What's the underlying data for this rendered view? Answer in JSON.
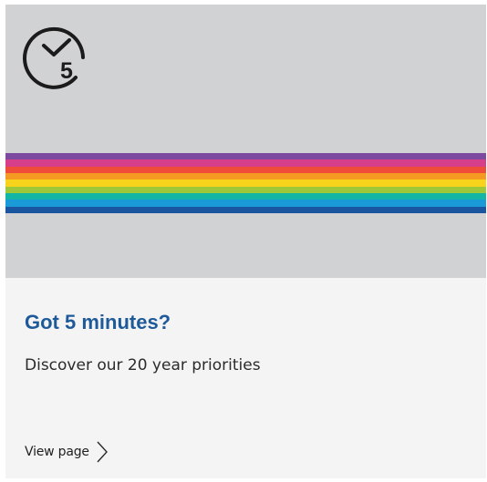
{
  "card": {
    "icon": {
      "name": "clock-5-minutes-icon",
      "number": "5"
    },
    "banner": {
      "stripes": [
        "#7c4a9e",
        "#d83f8a",
        "#ef4c39",
        "#f49a22",
        "#f8d31c",
        "#9ec83a",
        "#13b5a4",
        "#1a9ad6",
        "#1a56a0"
      ]
    },
    "title": "Got 5 minutes?",
    "description": "Discover our 20 year priorities",
    "link": {
      "label": "View page",
      "icon": "chevron-right-icon"
    },
    "colors": {
      "hero_bg": "#d1d2d4",
      "body_bg": "#f4f4f4",
      "title": "#1e5a99",
      "text": "#2b2b2b"
    }
  }
}
